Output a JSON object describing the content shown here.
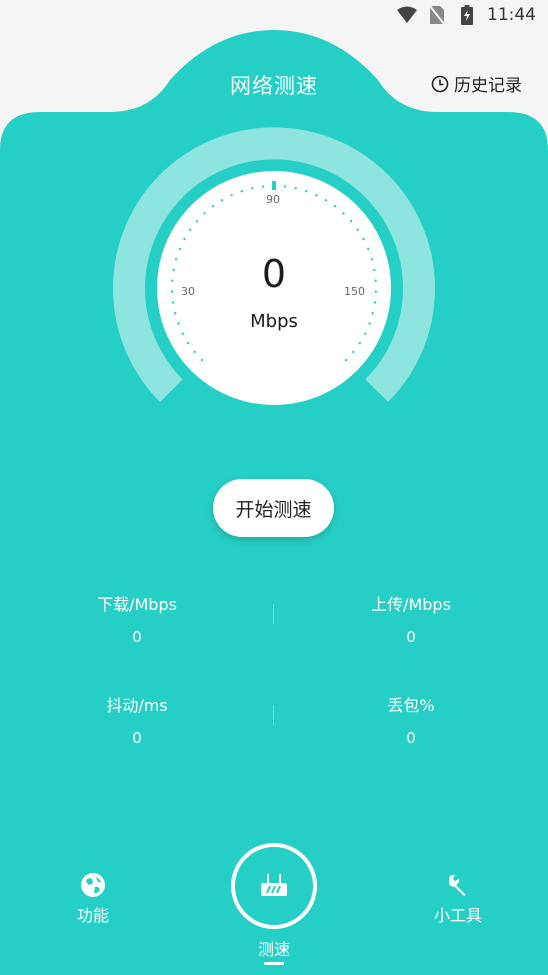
{
  "status_bar": {
    "time": "11:44",
    "wifi_icon": "wifi-icon",
    "signal_icon": "no-sim-icon",
    "battery_icon": "battery-charging-icon"
  },
  "header": {
    "title": "网络测速",
    "history_label": "历史记录",
    "history_icon": "clock-icon"
  },
  "gauge": {
    "value": "0",
    "unit": "Mbps",
    "ticks": [
      "30",
      "90",
      "150"
    ],
    "accent": "#26cfc5"
  },
  "start_button": {
    "label": "开始测速"
  },
  "stats": {
    "download": {
      "label": "下载/Mbps",
      "value": "0"
    },
    "upload": {
      "label": "上传/Mbps",
      "value": "0"
    },
    "jitter": {
      "label": "抖动/ms",
      "value": "0"
    },
    "loss": {
      "label": "丢包%",
      "value": "0"
    }
  },
  "nav": {
    "features": {
      "label": "功能",
      "icon": "globe-icon"
    },
    "speedtest": {
      "label": "测速",
      "icon": "router-icon"
    },
    "tools": {
      "label": "小工具",
      "icon": "wrench-icon"
    }
  }
}
